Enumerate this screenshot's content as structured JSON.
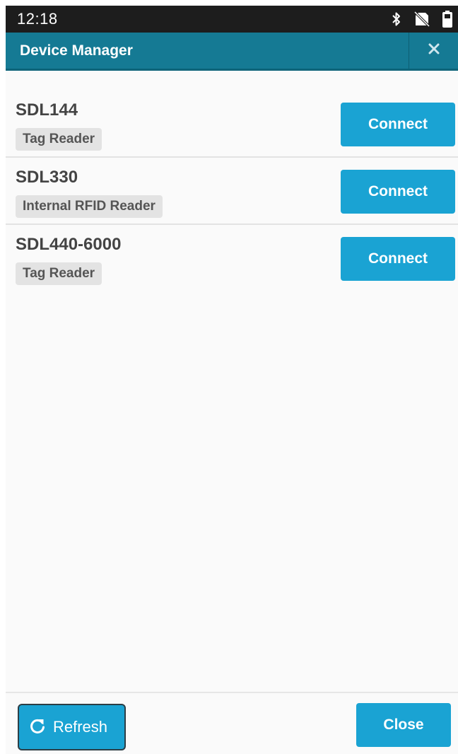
{
  "status_bar": {
    "time": "12:18",
    "icons": [
      "bluetooth-icon",
      "no-sim-icon",
      "battery-icon"
    ]
  },
  "app_bar": {
    "title": "Device Manager",
    "close_icon": "close-icon"
  },
  "devices": [
    {
      "name": "SDL144",
      "type": "Tag Reader",
      "action": "Connect"
    },
    {
      "name": "SDL330",
      "type": "Internal RFID Reader",
      "action": "Connect"
    },
    {
      "name": "SDL440-6000",
      "type": "Tag Reader",
      "action": "Connect"
    }
  ],
  "footer": {
    "refresh_label": "Refresh",
    "refresh_icon": "refresh-icon",
    "close_label": "Close"
  },
  "colors": {
    "status_bar": "#1d1d1d",
    "app_bar": "#157a94",
    "button": "#1aa3d3",
    "tag_background": "#e3e3e3",
    "page_background": "#fafafa"
  }
}
